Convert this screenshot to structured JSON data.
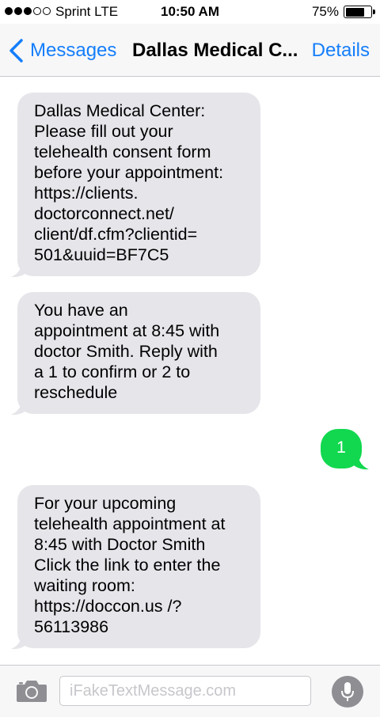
{
  "status_bar": {
    "signal_bars_filled": 3,
    "signal_bars_total": 5,
    "carrier": "Sprint  LTE",
    "time": "10:50 AM",
    "battery_percent_label": "75%",
    "battery_level": 0.75
  },
  "nav": {
    "back_label": "Messages",
    "title": "Dallas Medical C...",
    "details_label": "Details"
  },
  "messages": [
    {
      "direction": "incoming",
      "text": "Dallas Medical Center:\nPlease fill out your\ntelehealth consent form\nbefore your appointment:\nhttps://clients.\ndoctorconnect.net/\nclient/df.cfm?clientid=\n501&uuid=BF7C5"
    },
    {
      "direction": "incoming",
      "text": "You have an\nappointment at 8:45 with\ndoctor Smith. Reply with\na 1 to confirm or 2 to\nreschedule"
    },
    {
      "direction": "outgoing",
      "text": "1"
    },
    {
      "direction": "incoming",
      "text": "For your upcoming\ntelehealth appointment at\n8:45 with Doctor Smith\nClick the link to enter the\nwaiting room:\nhttps://doccon.us /?\n56113986"
    }
  ],
  "input_bar": {
    "placeholder": "iFakeTextMessage.com",
    "value": ""
  },
  "icons": {
    "back": "chevron-left-icon",
    "camera": "camera-icon",
    "mic": "microphone-icon"
  },
  "colors": {
    "accent": "#157efb",
    "incoming_bubble": "#e5e5ea",
    "outgoing_bubble": "#11d84f"
  }
}
